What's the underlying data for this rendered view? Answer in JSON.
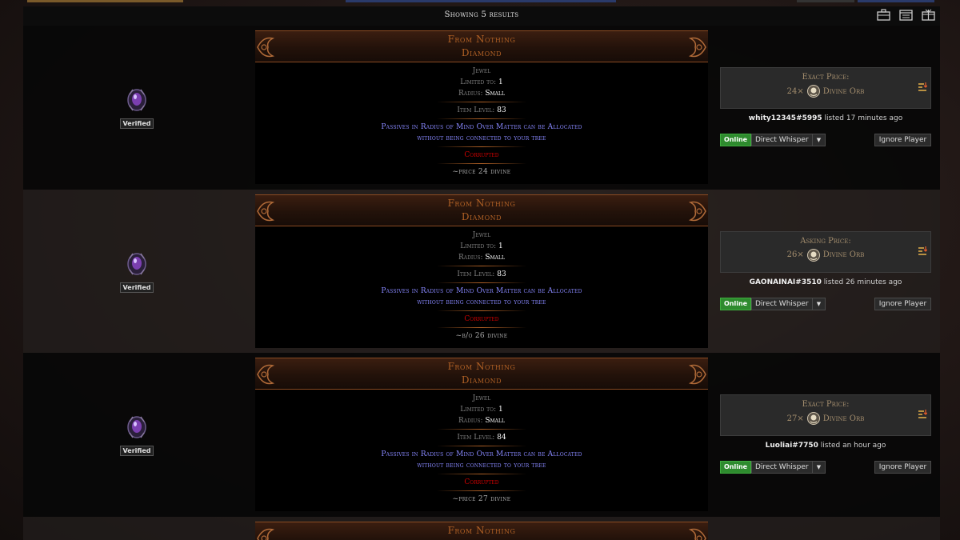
{
  "results": {
    "count_text": "Showing 5 results"
  },
  "view_icons": [
    "briefcase-icon",
    "calendar-icon",
    "gift-icon"
  ],
  "listings": [
    {
      "item_name": "From Nothing",
      "item_base": "Diamond",
      "item_type": "Jewel",
      "limited_label": "Limited to:",
      "limited_value": "1",
      "radius_label": "Radius:",
      "radius_value": "Small",
      "ilvl_label": "Item Level:",
      "ilvl_value": "83",
      "mod_line1": "Passives in Radius of Mind Over Matter can be Allocated",
      "mod_line2": "without being connected to your tree",
      "corrupted": "Corrupted",
      "note": "~price 24 divine",
      "verified": "Verified",
      "price_label": "Exact Price:",
      "price_amount": "24×",
      "currency": "Divine Orb",
      "seller": "whity12345#5995",
      "listed": "listed 17 minutes ago",
      "online": "Online",
      "whisper": "Direct Whisper",
      "ignore": "Ignore Player"
    },
    {
      "item_name": "From Nothing",
      "item_base": "Diamond",
      "item_type": "Jewel",
      "limited_label": "Limited to:",
      "limited_value": "1",
      "radius_label": "Radius:",
      "radius_value": "Small",
      "ilvl_label": "Item Level:",
      "ilvl_value": "83",
      "mod_line1": "Passives in Radius of Mind Over Matter can be Allocated",
      "mod_line2": "without being connected to your tree",
      "corrupted": "Corrupted",
      "note": "~b/o 26 divine",
      "verified": "Verified",
      "price_label": "Asking Price:",
      "price_amount": "26×",
      "currency": "Divine Orb",
      "seller": "GAONAINAI#3510",
      "listed": "listed 26 minutes ago",
      "online": "Online",
      "whisper": "Direct Whisper",
      "ignore": "Ignore Player"
    },
    {
      "item_name": "From Nothing",
      "item_base": "Diamond",
      "item_type": "Jewel",
      "limited_label": "Limited to:",
      "limited_value": "1",
      "radius_label": "Radius:",
      "radius_value": "Small",
      "ilvl_label": "Item Level:",
      "ilvl_value": "84",
      "mod_line1": "Passives in Radius of Mind Over Matter can be Allocated",
      "mod_line2": "without being connected to your tree",
      "corrupted": "Corrupted",
      "note": "~price 27 divine",
      "verified": "Verified",
      "price_label": "Exact Price:",
      "price_amount": "27×",
      "currency": "Divine Orb",
      "seller": "Luoliai#7750",
      "listed": "listed an hour ago",
      "online": "Online",
      "whisper": "Direct Whisper",
      "ignore": "Ignore Player"
    },
    {
      "item_name": "From Nothing"
    }
  ]
}
